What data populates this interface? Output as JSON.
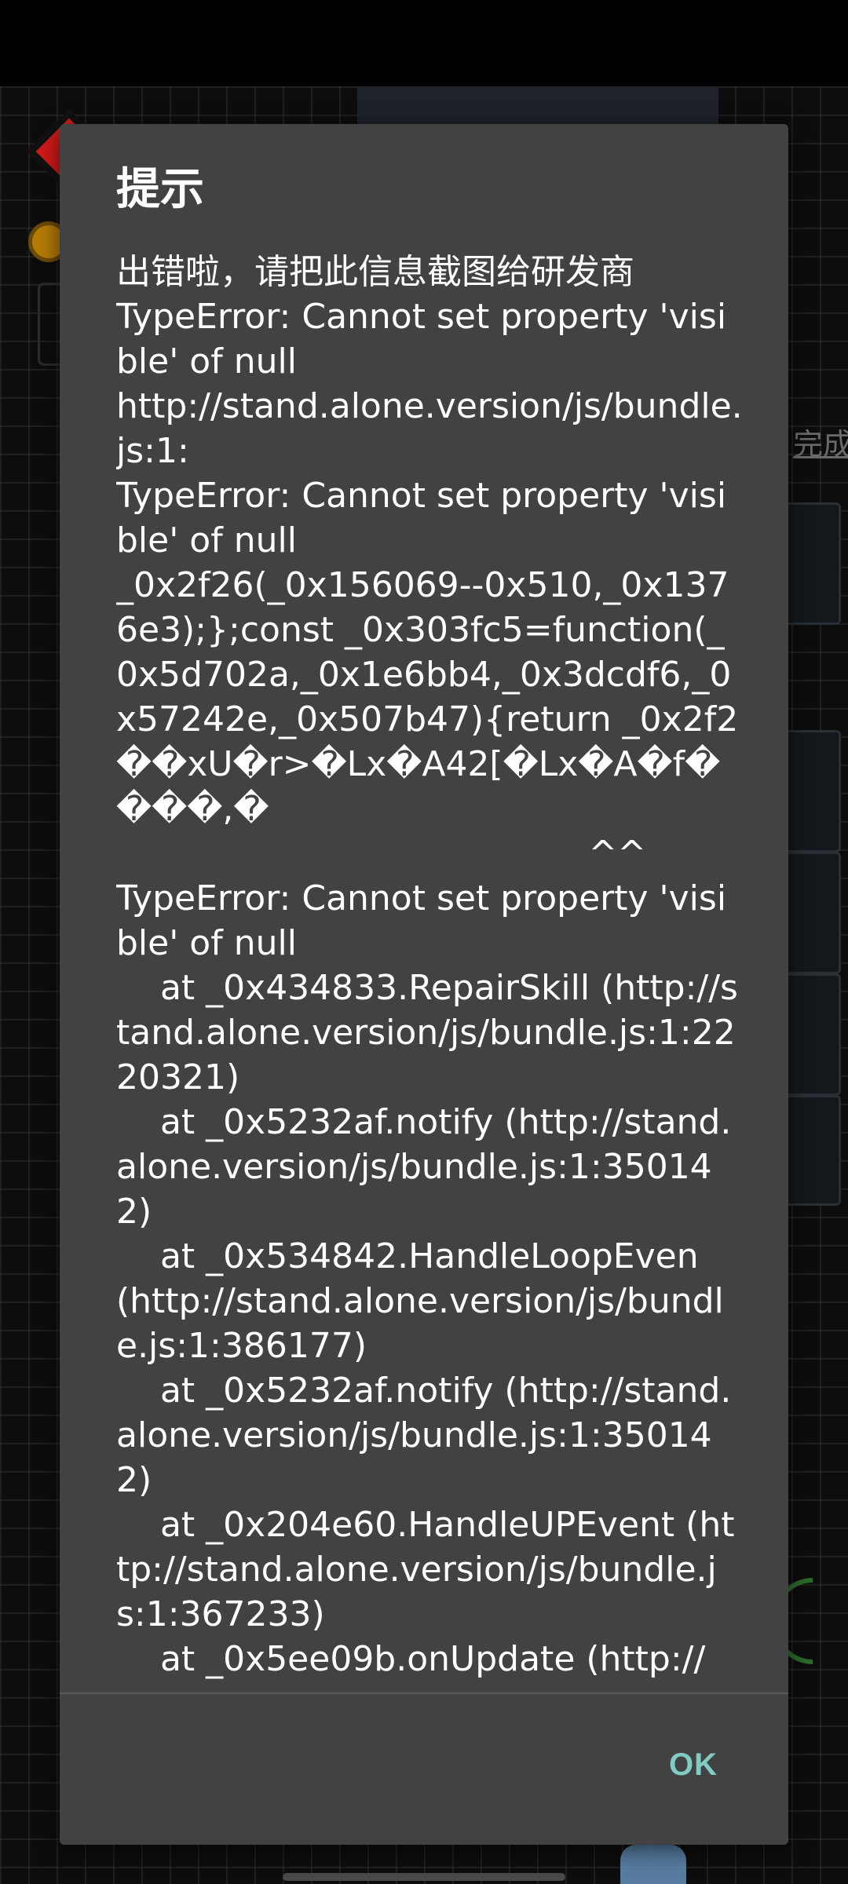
{
  "background": {
    "complete_label": "完成"
  },
  "dialog": {
    "title": "提示",
    "message_lines": [
      "出错啦，请把此信息截图给研发商",
      "TypeError: Cannot set property 'visible' of null",
      "http://stand.alone.version/js/bundle.js:1:",
      "TypeError: Cannot set property 'visible' of null",
      "_0x2f26(_0x156069--0x510,_0x1376e3);};const _0x303fc5=function(_0x5d702a,_0x1e6bb4,_0x3dcdf6,_0x57242e,_0x507b47){return _0x2f2��xU�r>�Lx�A42[�Lx�A�f����,�",
      "                                           ^^",
      "TypeError: Cannot set property 'visible' of null",
      "    at _0x434833.RepairSkill (http://stand.alone.version/js/bundle.js:1:2220321)",
      "    at _0x5232af.notify (http://stand.alone.version/js/bundle.js:1:350142)",
      "    at _0x534842.HandleLoopEven (http://stand.alone.version/js/bundle.js:1:386177)",
      "    at _0x5232af.notify (http://stand.alone.version/js/bundle.js:1:350142)",
      "    at _0x204e60.HandleUPEvent (http://stand.alone.version/js/bundle.js:1:367233)",
      "    at _0x5ee09b.onUpdate (http://"
    ],
    "ok_label": "OK"
  },
  "colors": {
    "dialog_bg": "#424242",
    "text": "#ffffff",
    "accent": "#80cbc4"
  }
}
